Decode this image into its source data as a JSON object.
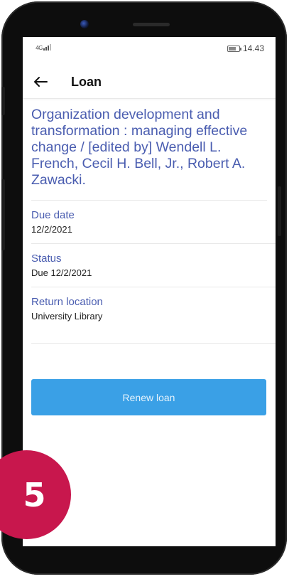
{
  "status_bar": {
    "signal": "4G",
    "time": "14.43"
  },
  "app_bar": {
    "back_icon": "arrow-left-icon",
    "title": "Loan"
  },
  "loan": {
    "title": "Organization development and transformation : managing effective change / [edited by] Wendell L. French, Cecil H. Bell, Jr., Robert A. Zawacki.",
    "fields": [
      {
        "label": "Due date",
        "value": "12/2/2021"
      },
      {
        "label": "Status",
        "value": "Due 12/2/2021"
      },
      {
        "label": "Return location",
        "value": "University Library"
      }
    ],
    "renew_label": "Renew loan"
  },
  "step_badge": "5",
  "colors": {
    "accent_text": "#4a5db0",
    "renew_button": "#3aa0e6",
    "badge": "#c8174d"
  }
}
